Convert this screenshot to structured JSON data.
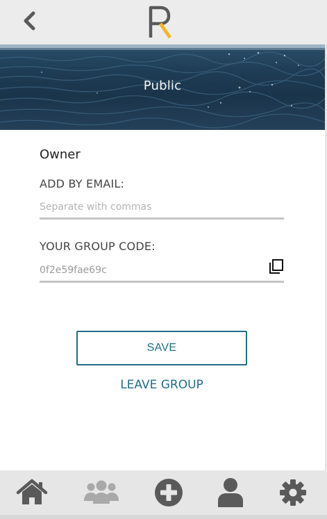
{
  "header": {
    "back_icon": "chevron-left-icon",
    "logo_text": "R",
    "logo_accent_color": "#f2b62a"
  },
  "banner": {
    "title": "Public"
  },
  "form": {
    "role": "Owner",
    "add_by_email": {
      "label": "ADD BY EMAIL:",
      "placeholder": "Separate with commas",
      "value": ""
    },
    "group_code": {
      "label": "YOUR GROUP CODE:",
      "value": "0f2e59fae69c",
      "copy_icon": "copy-icon"
    }
  },
  "actions": {
    "save_label": "SAVE",
    "leave_label": "LEAVE GROUP"
  },
  "nav": {
    "items": [
      {
        "icon": "home-icon",
        "active": true
      },
      {
        "icon": "group-icon",
        "active": false
      },
      {
        "icon": "add-circle-icon",
        "active": true
      },
      {
        "icon": "user-icon",
        "active": true
      },
      {
        "icon": "settings-icon",
        "active": true
      }
    ]
  },
  "colors": {
    "accent": "#1f6e86",
    "icon_dark": "#5a5a5a",
    "icon_muted": "#a9a9a9",
    "header_bg": "#ececec"
  }
}
